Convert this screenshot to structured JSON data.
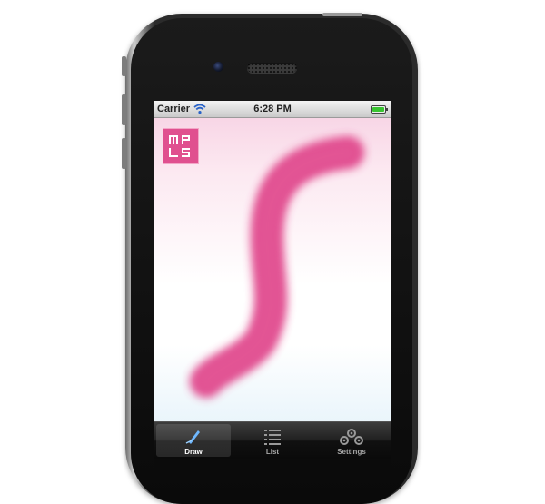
{
  "status_bar": {
    "carrier": "Carrier",
    "time": "6:28 PM",
    "battery_color": "#39c431"
  },
  "canvas": {
    "stroke_color": "#e0448a",
    "logo_icon": "mpls-logo-icon",
    "logo_color": "#e0508f"
  },
  "tab_bar": {
    "tabs": [
      {
        "label": "Draw",
        "icon": "pen-icon",
        "active": true
      },
      {
        "label": "List",
        "icon": "list-icon",
        "active": false
      },
      {
        "label": "Settings",
        "icon": "gears-icon",
        "active": false
      }
    ]
  }
}
